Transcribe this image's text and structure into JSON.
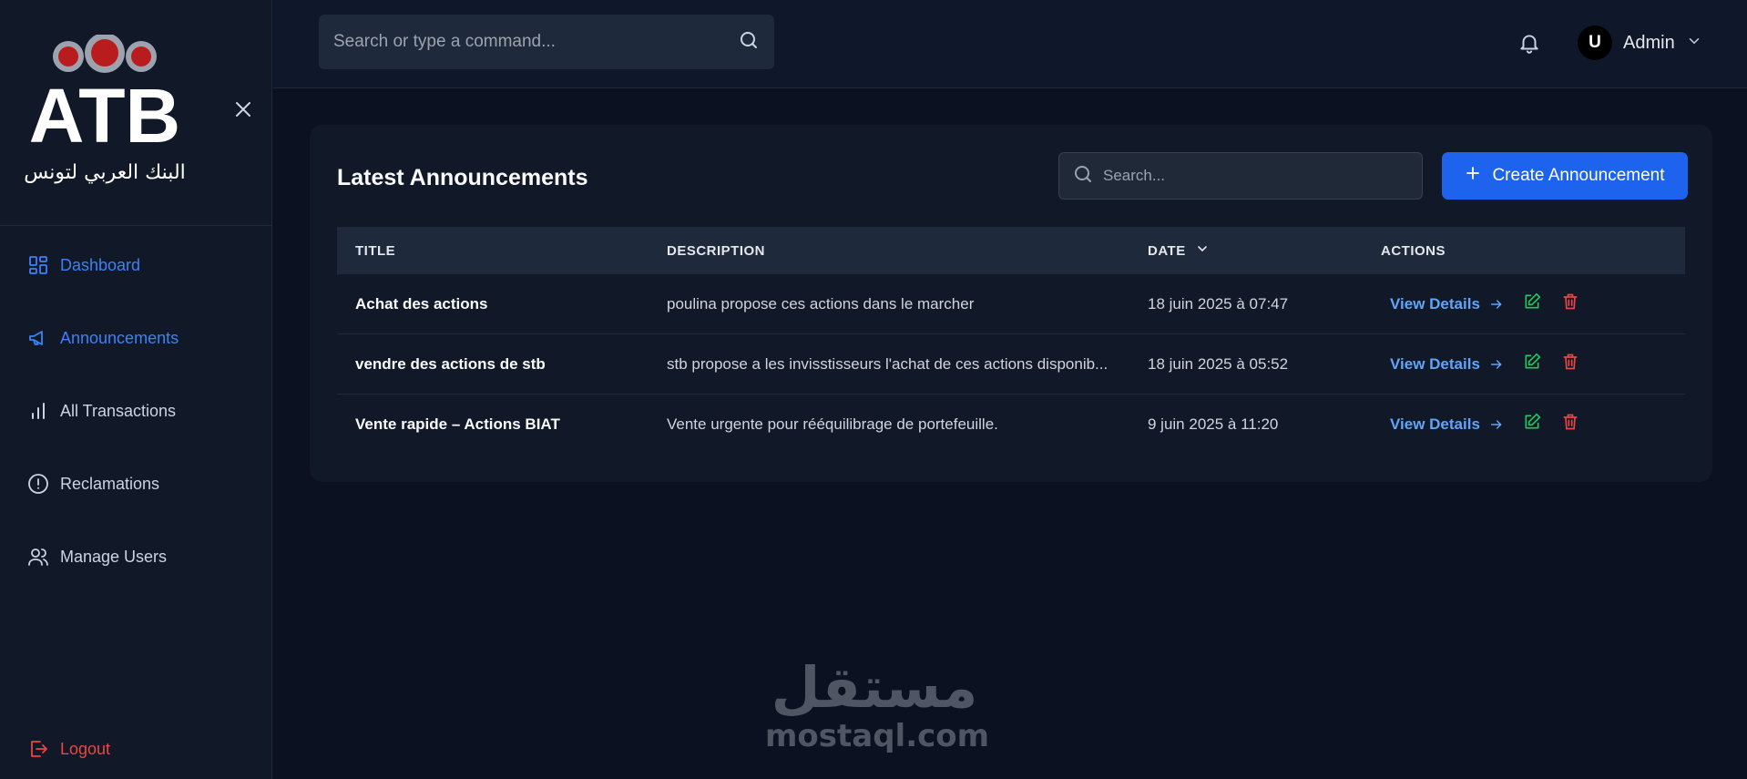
{
  "brand": {
    "logo_text": "ATB",
    "logo_arabic": "البنك العربي لتونس"
  },
  "sidebar": {
    "items": [
      {
        "label": "Dashboard",
        "icon": "dashboard-icon"
      },
      {
        "label": "Announcements",
        "icon": "megaphone-icon"
      },
      {
        "label": "All Transactions",
        "icon": "bar-chart-icon"
      },
      {
        "label": "Reclamations",
        "icon": "alert-circle-icon"
      },
      {
        "label": "Manage Users",
        "icon": "users-icon"
      }
    ],
    "active": "Announcements",
    "logout_label": "Logout"
  },
  "topbar": {
    "search_placeholder": "Search or type a command...",
    "user": {
      "initial": "U",
      "name": "Admin"
    }
  },
  "announcements": {
    "title": "Latest Announcements",
    "search_placeholder": "Search...",
    "create_label": "Create Announcement",
    "columns": {
      "title": "TITLE",
      "description": "DESCRIPTION",
      "date": "DATE",
      "actions": "ACTIONS"
    },
    "view_label": "View Details",
    "rows": [
      {
        "title": "Achat des actions",
        "description": "poulina propose ces actions dans le marcher",
        "date": "18 juin 2025 à 07:47"
      },
      {
        "title": "vendre des actions de stb",
        "description": "stb propose a les invisstisseurs l'achat de ces actions disponib...",
        "date": "18 juin 2025 à 05:52"
      },
      {
        "title": "Vente rapide – Actions BIAT",
        "description": "Vente urgente pour rééquilibrage de portefeuille.",
        "date": "9 juin 2025 à 11:20"
      }
    ]
  },
  "watermark": {
    "arabic": "مستقل",
    "latin": "mostaql.com"
  },
  "colors": {
    "accent": "#1d63ed",
    "active_nav": "#3b82f6",
    "link": "#60a5fa",
    "edit": "#22c55e",
    "delete": "#ef4444",
    "logout": "#ef4444"
  }
}
